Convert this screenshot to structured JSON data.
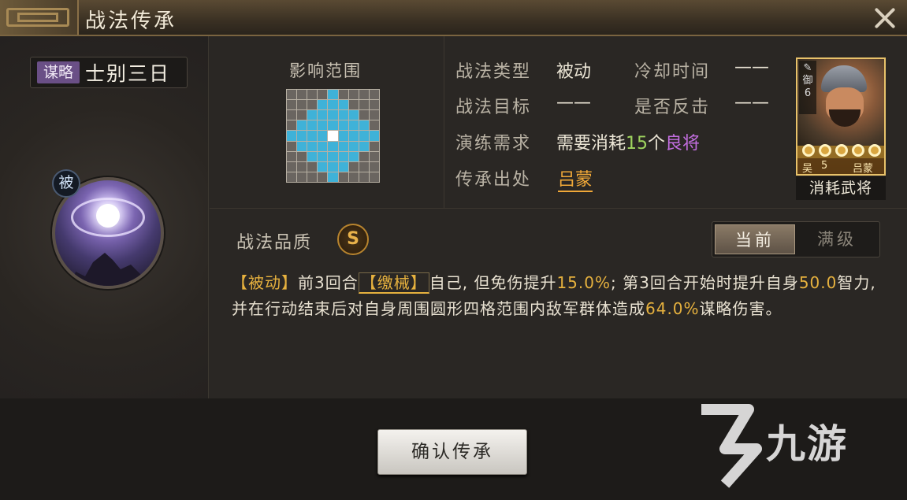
{
  "title": "战法传承",
  "skill": {
    "type_tag": "谋略",
    "name": "士别三日",
    "badge": "被"
  },
  "range": {
    "title": "影响范围"
  },
  "info": {
    "type_label": "战法类型",
    "type_value": "被动",
    "cooldown_label": "冷却时间",
    "cooldown_value": "——",
    "target_label": "战法目标",
    "target_value": "——",
    "counter_label": "是否反击",
    "counter_value": "——",
    "practice_label": "演练需求",
    "practice_prefix": "需要消耗",
    "practice_count": "15",
    "practice_unit": "个",
    "practice_item": "良将",
    "source_label": "传承出处",
    "source_value": "吕蒙"
  },
  "general": {
    "side": "御",
    "level": "6",
    "faction": "吴",
    "cost": "5",
    "name": "吕蒙",
    "caption": "消耗武将",
    "stars": 5
  },
  "quality": {
    "label": "战法品质",
    "grade": "S"
  },
  "tabs": {
    "current": "当前",
    "max": "满级"
  },
  "desc": {
    "p1": "【被动】",
    "p2": "前3回合",
    "p3": "【缴械】",
    "p4": "自己, 但免伤提升",
    "p5": "15.0%",
    "p6": "; 第3回合开始时提升自身",
    "p7": "50.0",
    "p8": "智力, 并在行动结束后对自身周围圆形四格范围内敌军群体造成",
    "p9": "64.0%",
    "p10": "谋略伤害。"
  },
  "confirm_label": "确认传承",
  "watermark": "九游",
  "colors": {
    "range_hit": "#3fb2d8",
    "range_self": "#ffffff",
    "gold": "#e6b13e"
  }
}
